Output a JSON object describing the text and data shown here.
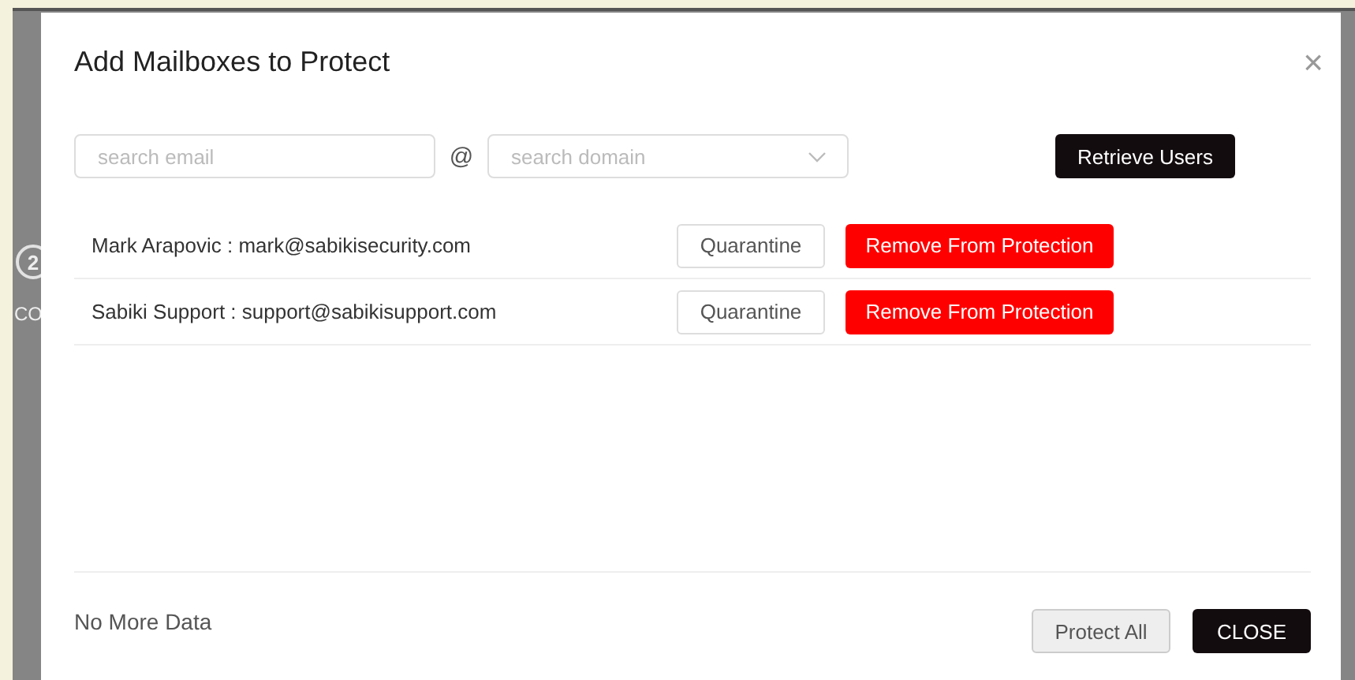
{
  "background": {
    "step_number": "2",
    "step_label": "CO"
  },
  "dialog": {
    "title": "Add Mailboxes to Protect",
    "close_icon": "×"
  },
  "search": {
    "email_placeholder": "search email",
    "at_sign": "@",
    "domain_placeholder": "search domain",
    "retrieve_button": "Retrieve Users"
  },
  "users": [
    {
      "label": "Mark Arapovic : mark@sabikisecurity.com",
      "quarantine": "Quarantine",
      "remove": "Remove From Protection"
    },
    {
      "label": "Sabiki Support : support@sabikisupport.com",
      "quarantine": "Quarantine",
      "remove": "Remove From Protection"
    }
  ],
  "footer": {
    "status": "No More Data",
    "protect_all": "Protect All",
    "close": "CLOSE"
  }
}
